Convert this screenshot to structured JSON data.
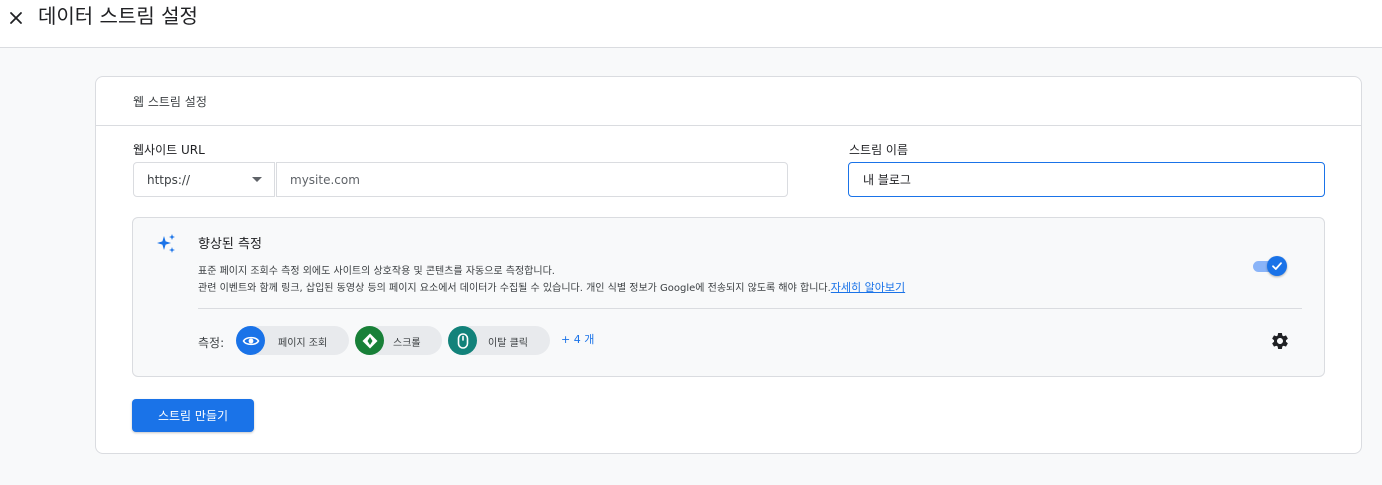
{
  "header": {
    "title": "데이터 스트림 설정"
  },
  "card": {
    "title": "웹 스트림 설정",
    "url_label": "웹사이트 URL",
    "protocol_value": "https://",
    "url_placeholder": "mysite.com",
    "stream_name_label": "스트림 이름",
    "stream_name_value": "내 블로그"
  },
  "measurement": {
    "title": "향상된 측정",
    "description_line1": "표준 페이지 조회수 측정 외에도 사이트의 상호작용 및 콘텐츠를 자동으로 측정합니다.",
    "description_line2": "관련 이벤트와 함께 링크, 삽입된 동영상 등의 페이지 요소에서 데이터가 수집될 수 있습니다. 개인 식별 정보가 Google에 전송되지 않도록 해야 합니다.",
    "learn_more": "자세히 알아보기",
    "toggle_on": true,
    "measures_label": "측정:",
    "chips": [
      {
        "label": "페이지 조회",
        "icon": "eye-icon",
        "color": "#1a73e8"
      },
      {
        "label": "스크롤",
        "icon": "scroll-icon",
        "color": "#188038"
      },
      {
        "label": "이탈 클릭",
        "icon": "mouse-icon",
        "color": "#12827a"
      }
    ],
    "more": "+ 4 개"
  },
  "actions": {
    "create_label": "스트림 만들기"
  },
  "colors": {
    "accent": "#1a73e8",
    "border": "#dadce0",
    "background": "#f8f9fa"
  }
}
